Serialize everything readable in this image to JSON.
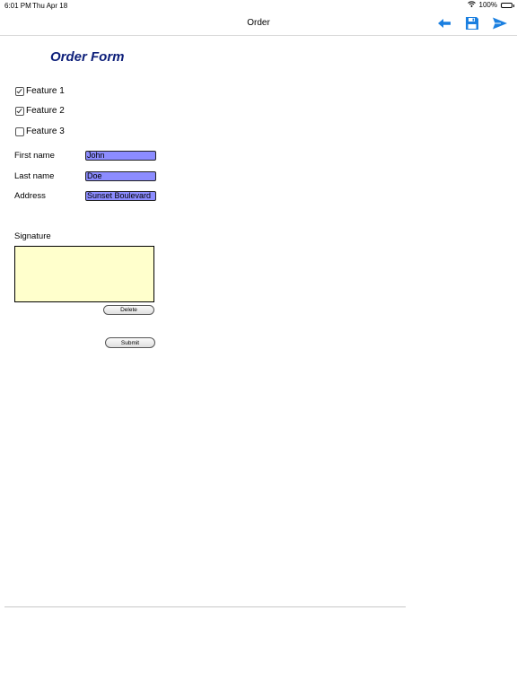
{
  "status": {
    "time": "6:01 PM",
    "date": "Thu Apr 18",
    "battery": "100%"
  },
  "navbar": {
    "title": "Order",
    "icons": [
      "arrow-left-icon",
      "save-icon",
      "send-icon"
    ],
    "accent": "#1a7fe0"
  },
  "form": {
    "title": "Order Form",
    "title_color": "#0d1f7a",
    "features": [
      {
        "label": "Feature 1",
        "checked": true
      },
      {
        "label": "Feature 2",
        "checked": true
      },
      {
        "label": "Feature 3",
        "checked": false
      }
    ],
    "fields": [
      {
        "label": "First name",
        "value": "John"
      },
      {
        "label": "Last name",
        "value": "Doe"
      },
      {
        "label": "Address",
        "value": "Sunset Boulevard"
      }
    ],
    "field_bg": "#8c8cff",
    "signature_label": "Signature",
    "signature_bg": "#ffffcc",
    "delete_label": "Delete",
    "submit_label": "Submit"
  }
}
